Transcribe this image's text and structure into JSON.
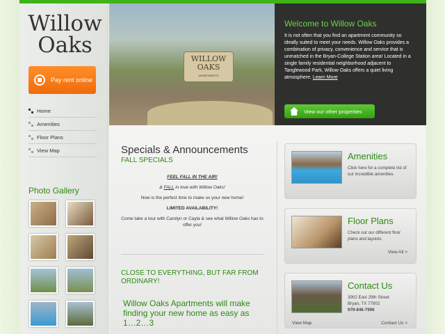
{
  "brand": {
    "line1": "Willow",
    "line2": "Oaks"
  },
  "pay_button": {
    "label": "Pay rent online"
  },
  "nav": [
    {
      "label": "Home"
    },
    {
      "label": "Amenities"
    },
    {
      "label": "Floor Plans"
    },
    {
      "label": "View Map"
    }
  ],
  "gallery": {
    "title": "Photo Gallery"
  },
  "hero": {
    "sign_line1": "WILLOW",
    "sign_line2": "OAKS",
    "sign_line3": "APARTMENTS",
    "heading": "Welcome to Willow Oaks",
    "body": "It is not often that you find an apartment community so ideally suited to meet your needs. Willow Oaks provides a combination of privacy, convenience and service that is unmatched in the Bryan-College Station area! Located in a single family residential neighborhood adjacent to Tanglewood Park, Willow Oaks offers a quiet living atmosphere.",
    "learn_more": "Learn More",
    "props_button": "View our other properties"
  },
  "specials": {
    "title": "Specials & Announcements",
    "subtitle": "FALL SPECIALS",
    "line1": "FEEL FALL IN THE AIR!",
    "line2_amp": "& ",
    "line2_fall": "FALL",
    "line2_rest": " in love with Willow Oaks!",
    "line3": "Now is the perfect time to make us your new home!",
    "line4": "LIMITED AVAILABILITY!",
    "line5": "Come take a tour with Carolyn or Cayla & see what Willow Oaks has to offer you!"
  },
  "promo": {
    "close_title": "CLOSE TO EVERYTHING, BUT FAR FROM ORDINARY!",
    "easy": "Willow Oaks Apartments will make finding your new home as easy as 1…2…3"
  },
  "cards": {
    "amenities": {
      "title": "Amenities",
      "text": "Click here for a complete list of our incredible amenities."
    },
    "floorplans": {
      "title": "Floor Plans",
      "text": "Check out our different floor plans and layouts.",
      "link": "View All >"
    },
    "contact": {
      "title": "Contact Us",
      "address1": "3902 East 29th Street",
      "address2": "Bryan, TX 77802",
      "phone": "979-846-7996",
      "map_link": "View Map",
      "contact_link": "Contact Us >"
    }
  },
  "colors": {
    "accent_green": "#2c8a12",
    "orange": "#ef6b0a",
    "dark_panel": "#2f302e"
  }
}
